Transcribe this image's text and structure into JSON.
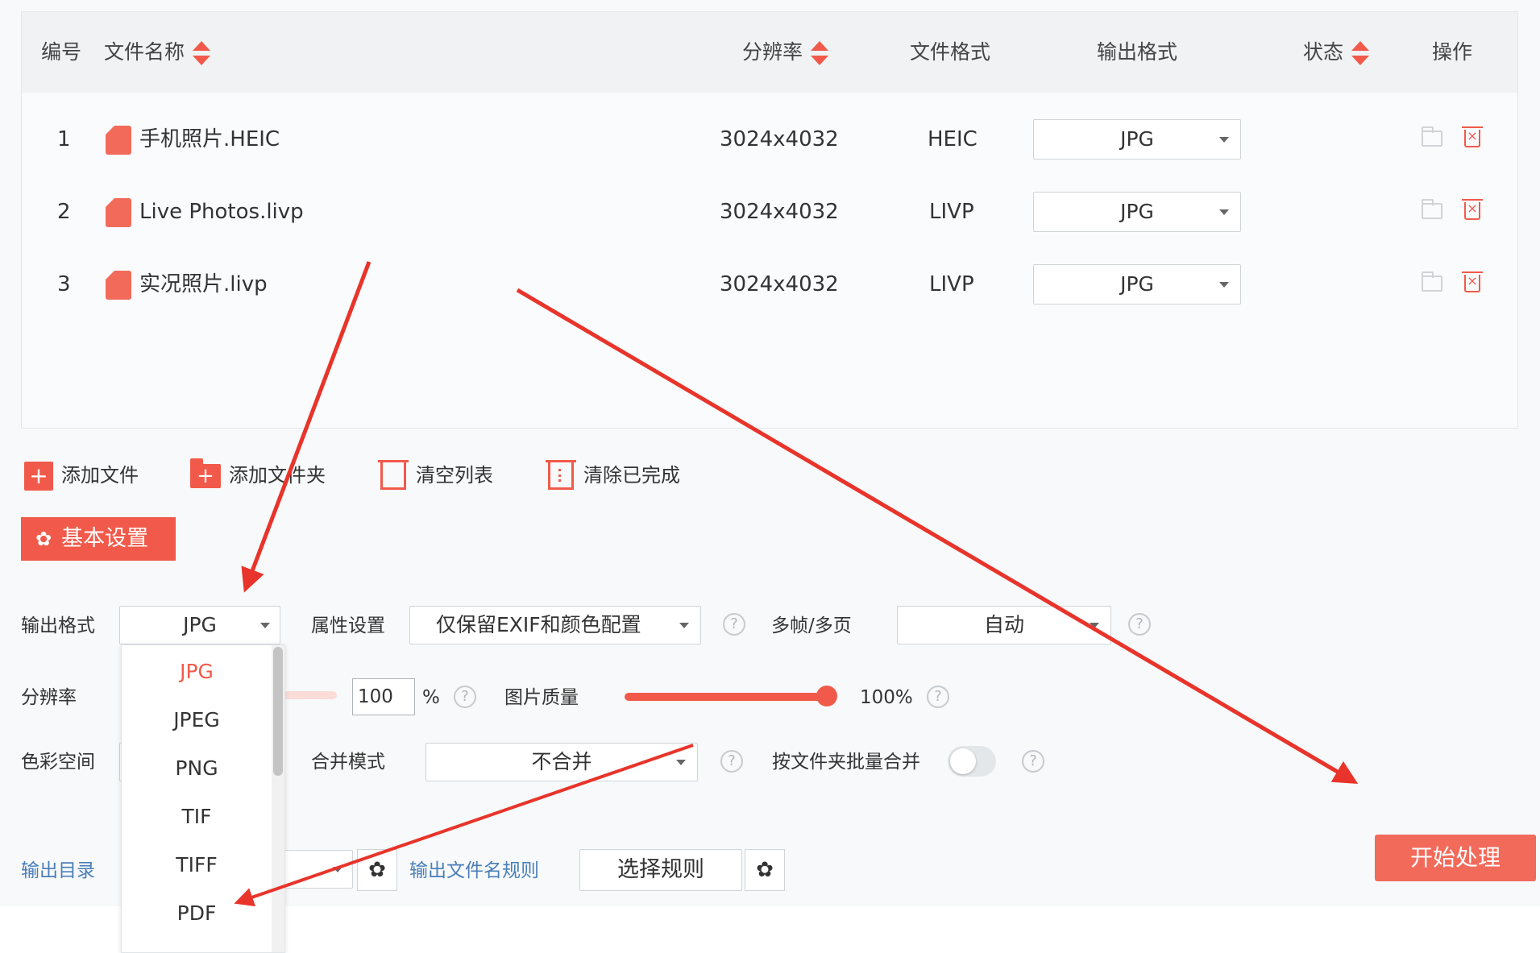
{
  "table": {
    "headers": {
      "num": "编号",
      "name": "文件名称",
      "resolution": "分辨率",
      "format": "文件格式",
      "output": "输出格式",
      "status": "状态",
      "ops": "操作"
    },
    "rows": [
      {
        "num": "1",
        "name": "手机照片.HEIC",
        "resolution": "3024x4032",
        "format": "HEIC",
        "output": "JPG"
      },
      {
        "num": "2",
        "name": "Live Photos.livp",
        "resolution": "3024x4032",
        "format": "LIVP",
        "output": "JPG"
      },
      {
        "num": "3",
        "name": "实况照片.livp",
        "resolution": "3024x4032",
        "format": "LIVP",
        "output": "JPG"
      }
    ]
  },
  "toolbar": {
    "add_file": "添加文件",
    "add_folder": "添加文件夹",
    "clear_list": "清空列表",
    "clear_done": "清除已完成"
  },
  "settings_tab": "基本设置",
  "settings": {
    "output_format_label": "输出格式",
    "output_format_value": "JPG",
    "attr_label": "属性设置",
    "attr_value": "仅保留EXIF和颜色配置",
    "multiframe_label": "多帧/多页",
    "multiframe_value": "自动",
    "resolution_label": "分辨率",
    "resolution_value": "100",
    "percent": "%",
    "quality_label": "图片质量",
    "quality_value": "100%",
    "quality_fraction": 1.0,
    "color_label": "色彩空间",
    "merge_label": "合并模式",
    "merge_value": "不合并",
    "batch_merge_label": "按文件夹批量合并",
    "batch_merge_on": false,
    "output_dir_label": "输出目录",
    "filename_rule_label": "输出文件名规则",
    "choose_rule": "选择规则"
  },
  "start_button": "开始处理",
  "dropdown": {
    "options": [
      "JPG",
      "JPEG",
      "PNG",
      "TIF",
      "TIFF",
      "PDF"
    ],
    "selected": "JPG"
  },
  "colors": {
    "accent": "#f15a4a",
    "arrow": "#e8342a",
    "selected_text": "#f15a4a"
  },
  "icons": {
    "sort": "sort-icon",
    "file": "file-icon",
    "folder": "folder-icon",
    "delete": "delete-icon",
    "gear": "gear-icon",
    "help": "help-icon",
    "caret": "caret-down-icon"
  }
}
